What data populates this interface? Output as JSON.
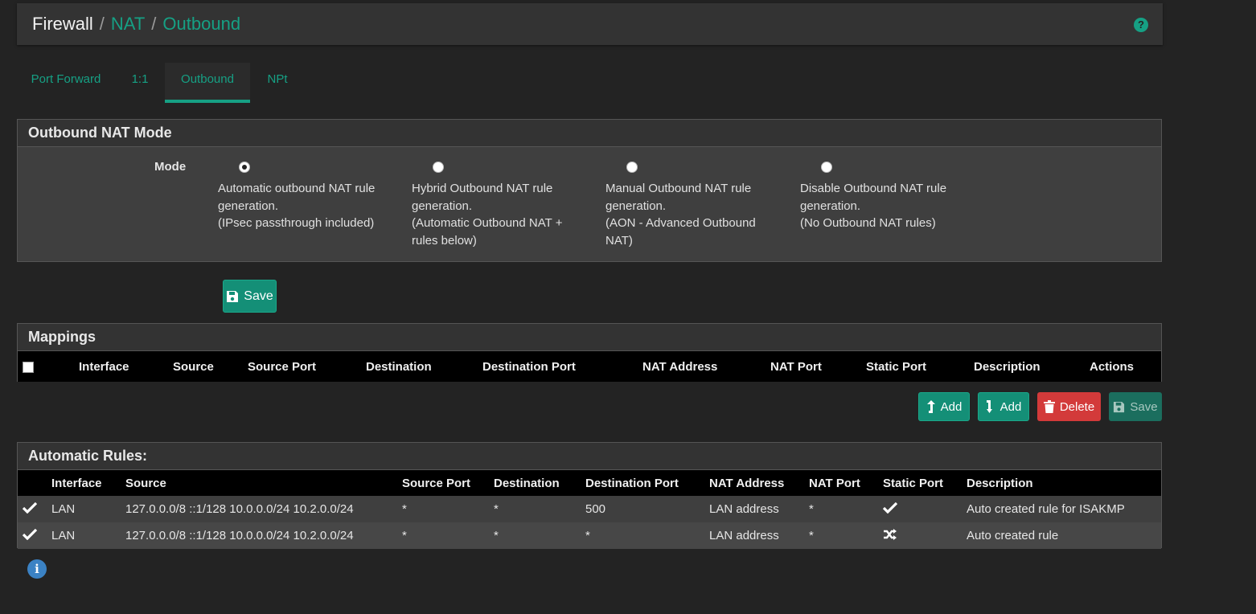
{
  "breadcrumb": {
    "root": "Firewall",
    "items": [
      "NAT",
      "Outbound"
    ]
  },
  "tabs": [
    {
      "label": "Port Forward",
      "active": false
    },
    {
      "label": "1:1",
      "active": false
    },
    {
      "label": "Outbound",
      "active": true
    },
    {
      "label": "NPt",
      "active": false
    }
  ],
  "mode_panel": {
    "title": "Outbound NAT Mode",
    "label": "Mode",
    "options": [
      {
        "lines": [
          "Automatic outbound NAT rule",
          "generation.",
          "(IPsec passthrough included)"
        ],
        "checked": true
      },
      {
        "lines": [
          "Hybrid Outbound NAT rule",
          "generation.",
          "(Automatic Outbound NAT +",
          "rules below)"
        ],
        "checked": false
      },
      {
        "lines": [
          "Manual Outbound NAT rule",
          "generation.",
          "(AON - Advanced Outbound",
          "NAT)"
        ],
        "checked": false
      },
      {
        "lines": [
          "Disable Outbound NAT rule",
          "generation.",
          "(No Outbound NAT rules)"
        ],
        "checked": false
      }
    ],
    "save_label": "Save"
  },
  "mappings": {
    "title": "Mappings",
    "columns": [
      "Interface",
      "Source",
      "Source Port",
      "Destination",
      "Destination Port",
      "NAT Address",
      "NAT Port",
      "Static Port",
      "Description",
      "Actions"
    ],
    "buttons": {
      "add_top": "Add",
      "add_bottom": "Add",
      "delete": "Delete",
      "save": "Save"
    }
  },
  "automatic_rules": {
    "title": "Automatic Rules:",
    "columns": [
      "Interface",
      "Source",
      "Source Port",
      "Destination",
      "Destination Port",
      "NAT Address",
      "NAT Port",
      "Static Port",
      "Description"
    ],
    "rows": [
      {
        "interface": "LAN",
        "source": "127.0.0.0/8 ::1/128 10.0.0.0/24 10.2.0.0/24",
        "source_port": "*",
        "destination": "*",
        "destination_port": "500",
        "nat_address": "LAN address",
        "nat_port": "*",
        "static_port_icon": "check-icon",
        "description": "Auto created rule for ISAKMP"
      },
      {
        "interface": "LAN",
        "source": "127.0.0.0/8 ::1/128 10.0.0.0/24 10.2.0.0/24",
        "source_port": "*",
        "destination": "*",
        "destination_port": "*",
        "nat_address": "LAN address",
        "nat_port": "*",
        "static_port_icon": "shuffle-icon",
        "description": "Auto created rule"
      }
    ]
  },
  "colors": {
    "accent": "#16a084",
    "danger": "#d33a3a",
    "background": "#232323",
    "panel": "#3f3f3f"
  }
}
